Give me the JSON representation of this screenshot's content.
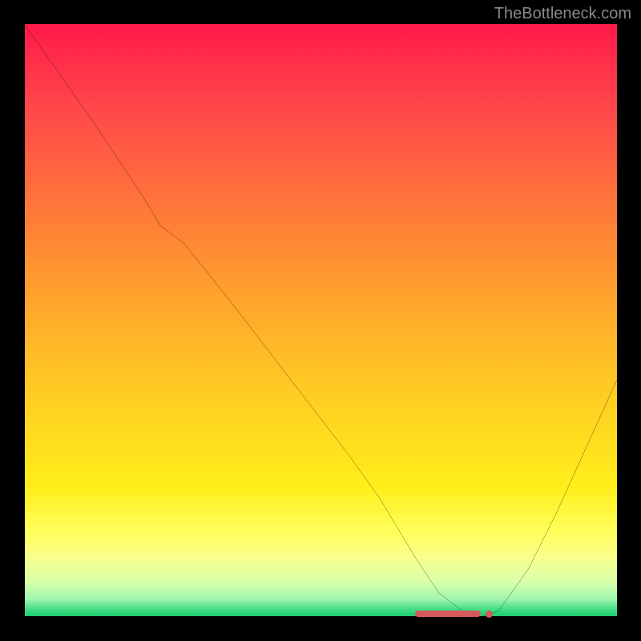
{
  "watermark": "TheBottleneck.com",
  "chart_data": {
    "type": "line",
    "title": "",
    "xlabel": "",
    "ylabel": "",
    "xlim": [
      0,
      100
    ],
    "ylim": [
      0,
      100
    ],
    "grid": false,
    "legend": false,
    "background_gradient": {
      "top": "#ff1a4a",
      "mid": "#ffd820",
      "bottom": "#18c96b"
    },
    "series": [
      {
        "name": "curve",
        "color": "#000000",
        "x": [
          0,
          5,
          12,
          20,
          23,
          27,
          35,
          45,
          55,
          60,
          63,
          66,
          70,
          74,
          77,
          80,
          85,
          90,
          95,
          100
        ],
        "y": [
          100,
          93,
          83,
          71,
          66,
          63,
          53,
          40,
          27,
          20,
          15,
          10,
          4,
          1,
          0,
          1,
          8,
          18,
          29,
          40
        ]
      }
    ],
    "annotations": [
      {
        "type": "hbar",
        "x0": 66,
        "x1": 77,
        "y": 0.5,
        "color": "#d65a5a"
      },
      {
        "type": "dot",
        "x": 78.5,
        "y": 0.5,
        "color": "#d65a5a"
      }
    ]
  }
}
